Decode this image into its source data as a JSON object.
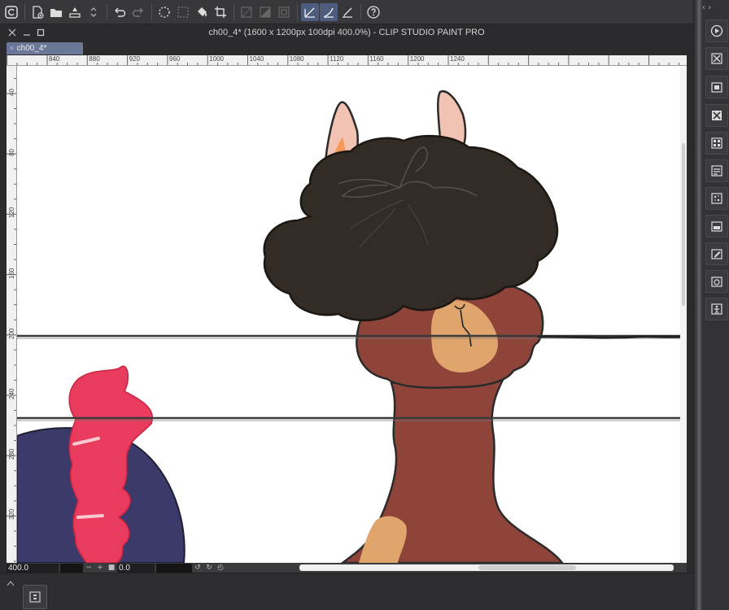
{
  "window": {
    "title": "ch00_4* (1600 x 1200px 100dpi 400.0%)  - CLIP STUDIO PAINT PRO"
  },
  "tab": {
    "label": "ch00_4*",
    "close_glyph": "×"
  },
  "ruler_top": {
    "labels": [
      "840",
      "880",
      "920",
      "960",
      "1000",
      "1040",
      "1080",
      "1120",
      "1160",
      "1200",
      "1240"
    ]
  },
  "ruler_left": {
    "labels": [
      "40",
      "80",
      "120",
      "160",
      "200",
      "240",
      "280",
      "320"
    ]
  },
  "statusbar": {
    "zoom": "400.0",
    "rotation": "0.0",
    "zoom_out_glyph": "−",
    "zoom_in_glyph": "+"
  },
  "toolbar": {
    "icons": [
      "clip-studio-logo-icon",
      "new-file-icon",
      "open-folder-icon",
      "save-icon",
      "undo-icon",
      "redo-icon",
      "clear-selection-icon",
      "select-icon",
      "fill-icon",
      "crop-icon",
      "snap-to-ruler-icon",
      "snap-to-guide-icon",
      "snap-to-grid-icon",
      "help-icon"
    ]
  },
  "colors": {
    "accent": "#4e5c80",
    "tab": "#6b7796",
    "hair": "#332b25",
    "llama_body": "#8e4439",
    "muzzle": "#e0a56c",
    "ear_inner": "#f2c2b3",
    "pink": "#e83b5d",
    "navy": "#3b3a6b"
  }
}
